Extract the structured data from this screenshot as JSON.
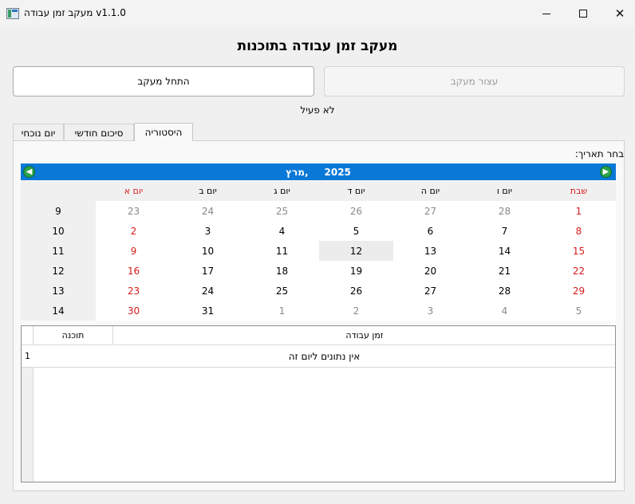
{
  "window": {
    "title": "מעקב זמן עבודה v1.1.0"
  },
  "header": {
    "title": "מעקב זמן עבודה בתוכנות"
  },
  "controls": {
    "start_label": "התחל מעקב",
    "stop_label": "עצור מעקב",
    "status": "לא פעיל"
  },
  "tabs": [
    {
      "label": "יום נוכחי"
    },
    {
      "label": "סיכום חודשי"
    },
    {
      "label": "היסטוריה"
    }
  ],
  "history": {
    "choose_date_label": "בחר תאריך:",
    "calendar": {
      "month": "מרץ,",
      "year": "2025",
      "day_names": [
        "שבת",
        "יום ו",
        "יום ה",
        "יום ד",
        "יום ג",
        "יום ב",
        "יום א"
      ],
      "weeks": [
        {
          "week": "9",
          "days": [
            "1",
            "28",
            "27",
            "26",
            "25",
            "24",
            "23"
          ]
        },
        {
          "week": "10",
          "days": [
            "8",
            "7",
            "6",
            "5",
            "4",
            "3",
            "2"
          ]
        },
        {
          "week": "11",
          "days": [
            "15",
            "14",
            "13",
            "12",
            "11",
            "10",
            "9"
          ]
        },
        {
          "week": "12",
          "days": [
            "22",
            "21",
            "20",
            "19",
            "18",
            "17",
            "16"
          ]
        },
        {
          "week": "13",
          "days": [
            "29",
            "28",
            "27",
            "26",
            "25",
            "24",
            "23"
          ]
        },
        {
          "week": "14",
          "days": [
            "5",
            "4",
            "3",
            "2",
            "1",
            "31",
            "30"
          ]
        }
      ],
      "selected_day": "12"
    },
    "table": {
      "headers": {
        "time": "זמן עבודה",
        "program": "תוכנה"
      },
      "rows": [
        {
          "num": "1",
          "message": "אין נתונים ליום זה"
        }
      ]
    }
  }
}
